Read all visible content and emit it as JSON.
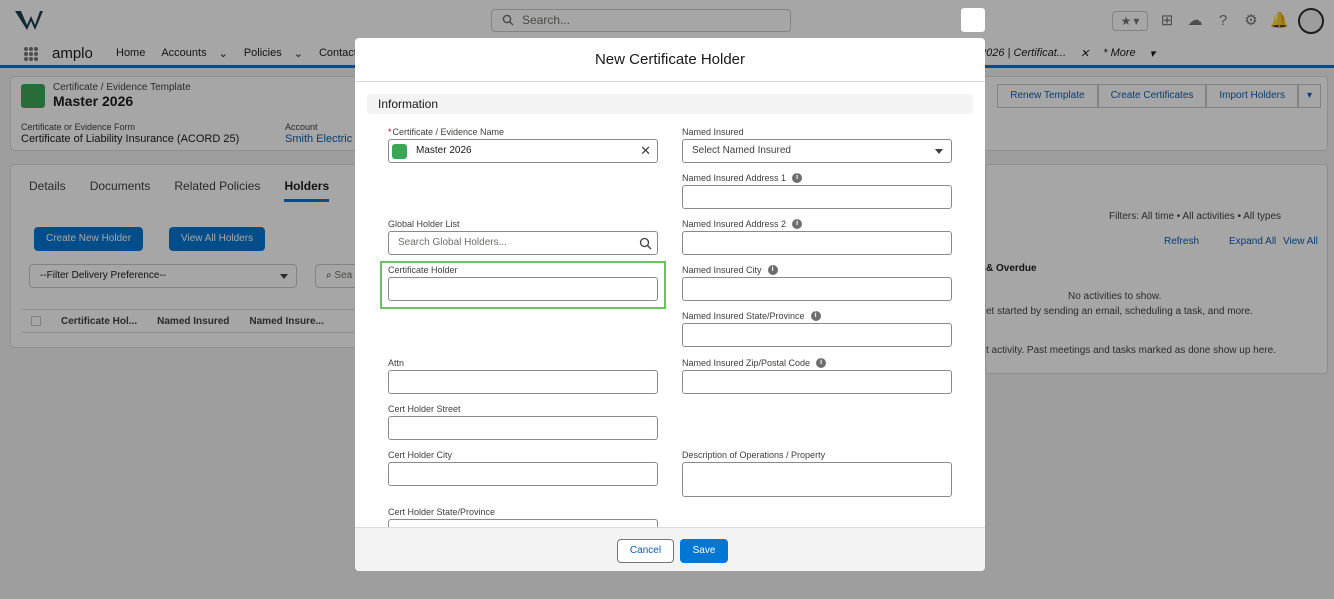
{
  "global_search": {
    "placeholder": "Search..."
  },
  "nav": {
    "app_name": "amplo",
    "items": [
      {
        "label": "Home",
        "has_menu": false
      },
      {
        "label": "Accounts",
        "has_menu": true
      },
      {
        "label": "Policies",
        "has_menu": true
      },
      {
        "label": "Contacts",
        "has_menu": false
      }
    ],
    "open_tab_label": "2026 | Certificat...",
    "more_label": "* More"
  },
  "record": {
    "object_label": "Certificate / Evidence Template",
    "title": "Master 2026",
    "form_label": "Certificate or Evidence Form",
    "form_value": "Certificate of Liability Insurance (ACORD 25)",
    "account_label": "Account",
    "account_value": "Smith Electric",
    "actions": [
      "Renew Template",
      "Create Certificates",
      "Import Holders"
    ]
  },
  "tabs": [
    "Details",
    "Documents",
    "Related Policies",
    "Holders"
  ],
  "active_tab": "Holders",
  "holders": {
    "create_button": "Create New Holder",
    "view_all_button": "View All Holders",
    "filter_value": "--Filter Delivery Preference--",
    "search_placeholder": "Sea",
    "columns": [
      "Certificate Hol...",
      "Named Insured",
      "Named Insure..."
    ]
  },
  "activity": {
    "filters_text": "Filters: All time • All activities • All types",
    "refresh": "Refresh",
    "expand_all": "Expand All",
    "view_all": "View All",
    "overdue_heading": "& Overdue",
    "empty_text": "No activities to show.",
    "hint_text": "et started by sending an email, scheduling a task, and more.",
    "past_text": "t activity. Past meetings and tasks marked as done show up here."
  },
  "modal": {
    "title": "New Certificate Holder",
    "section_title": "Information",
    "left_fields": {
      "cert_name_label": "Certificate / Evidence Name",
      "cert_name_value": "Master 2026",
      "global_holder_label": "Global Holder List",
      "global_holder_placeholder": "Search Global Holders...",
      "cert_holder_label": "Certificate Holder",
      "attn_label": "Attn",
      "street_label": "Cert Holder Street",
      "city_label": "Cert Holder City",
      "state_label": "Cert Holder State/Province"
    },
    "right_fields": {
      "named_insured_label": "Named Insured",
      "named_insured_placeholder": "Select Named Insured",
      "address1_label": "Named Insured Address 1",
      "address2_label": "Named Insured Address 2",
      "city_label": "Named Insured City",
      "state_label": "Named Insured State/Province",
      "zip_label": "Named Insured Zip/Postal Code",
      "description_label": "Description of Operations / Property"
    },
    "cancel_label": "Cancel",
    "save_label": "Save"
  },
  "colors": {
    "brand": "#0176d3",
    "icon_green": "#3ba755",
    "highlight": "#6ac262"
  }
}
